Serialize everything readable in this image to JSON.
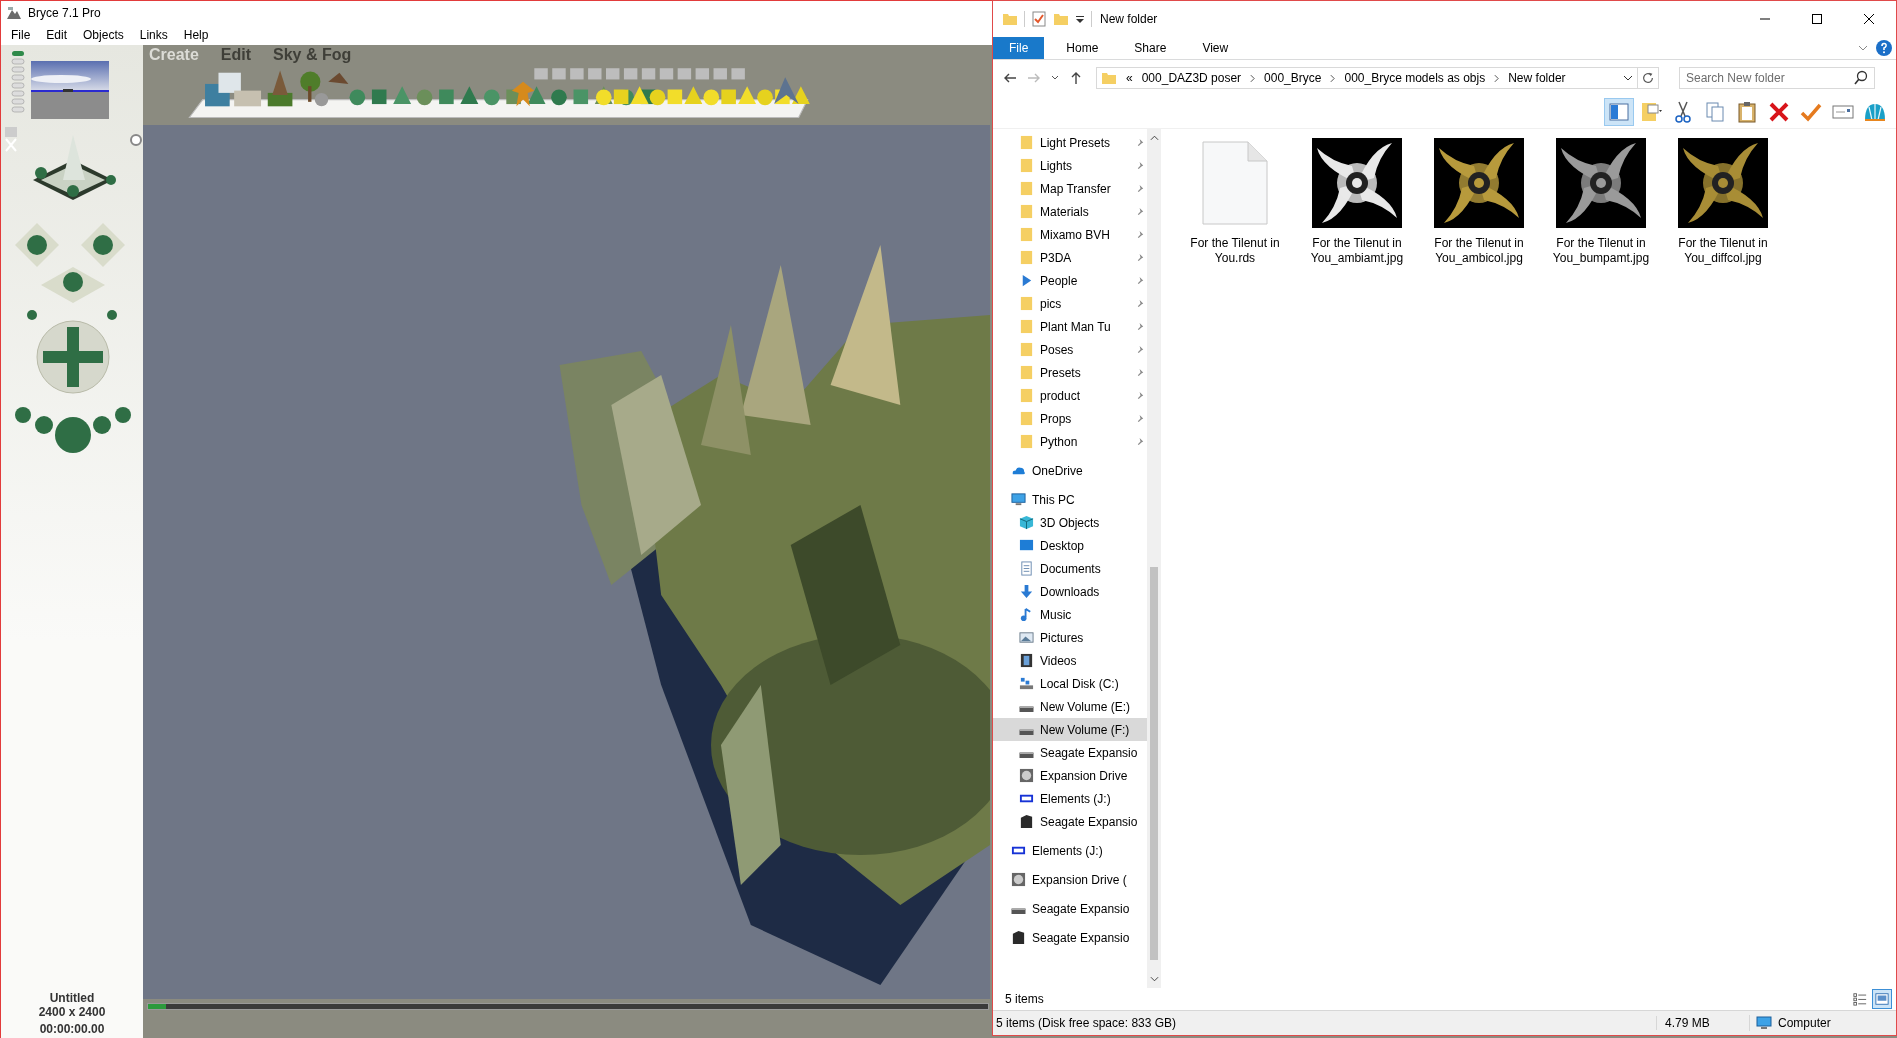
{
  "bryce": {
    "title": "Bryce 7.1  Pro",
    "menu": [
      "File",
      "Edit",
      "Objects",
      "Links",
      "Help"
    ],
    "palette_tabs": [
      {
        "label": "Create",
        "selected": true
      },
      {
        "label": "Edit",
        "selected": false
      },
      {
        "label": "Sky & Fog",
        "selected": false
      }
    ],
    "document": {
      "name": "Untitled",
      "size": "2400 x 2400",
      "time": "00:00:00.00"
    }
  },
  "explorer": {
    "title": "New folder",
    "ribbon_tabs": [
      {
        "label": "File",
        "kind": "file-menu"
      },
      {
        "label": "Home",
        "kind": "tab"
      },
      {
        "label": "Share",
        "kind": "tab"
      },
      {
        "label": "View",
        "kind": "tab"
      }
    ],
    "address": {
      "overflow": "«",
      "path": [
        "000_DAZ3D poser",
        "000_Bryce",
        "000_Bryce models as objs",
        "New folder"
      ]
    },
    "search": {
      "placeholder": "Search New folder"
    },
    "toolbar": [
      {
        "kind": "preview-pane",
        "on": true
      },
      {
        "kind": "properties"
      },
      {
        "kind": "cut"
      },
      {
        "kind": "copy"
      },
      {
        "kind": "paste"
      },
      {
        "kind": "delete"
      },
      {
        "kind": "check"
      },
      {
        "kind": "rename"
      },
      {
        "kind": "shell"
      }
    ],
    "quick_access": [
      {
        "label": "Light Presets",
        "kind": "folder",
        "pinned": true,
        "selected": false
      },
      {
        "label": "Lights",
        "kind": "folder",
        "pinned": true,
        "selected": false
      },
      {
        "label": "Map Transfer",
        "kind": "folder",
        "pinned": true,
        "selected": false
      },
      {
        "label": "Materials",
        "kind": "folder",
        "pinned": true,
        "selected": false
      },
      {
        "label": "Mixamo BVH",
        "kind": "folder",
        "pinned": true,
        "selected": false
      },
      {
        "label": "P3DA",
        "kind": "folder",
        "pinned": true,
        "selected": false
      },
      {
        "label": "People",
        "kind": "people",
        "pinned": true,
        "selected": false
      },
      {
        "label": "pics",
        "kind": "folder",
        "pinned": true,
        "selected": false
      },
      {
        "label": "Plant Man Tu",
        "kind": "folder",
        "pinned": true,
        "selected": false
      },
      {
        "label": "Poses",
        "kind": "folder",
        "pinned": true,
        "selected": false
      },
      {
        "label": "Presets",
        "kind": "folder",
        "pinned": true,
        "selected": false
      },
      {
        "label": "product",
        "kind": "folder",
        "pinned": true,
        "selected": false
      },
      {
        "label": "Props",
        "kind": "folder",
        "pinned": true,
        "selected": false
      },
      {
        "label": "Python",
        "kind": "folder",
        "pinned": true,
        "selected": false
      }
    ],
    "tree": [
      {
        "label": "OneDrive",
        "kind": "cloud",
        "selected": false
      },
      {
        "label": "This PC",
        "kind": "pc",
        "selected": false,
        "children": [
          {
            "label": "3D Objects",
            "kind": "cube",
            "selected": false
          },
          {
            "label": "Desktop",
            "kind": "desktop",
            "selected": false
          },
          {
            "label": "Documents",
            "kind": "document",
            "selected": false
          },
          {
            "label": "Downloads",
            "kind": "download",
            "selected": false
          },
          {
            "label": "Music",
            "kind": "music",
            "selected": false
          },
          {
            "label": "Pictures",
            "kind": "pictures",
            "selected": false
          },
          {
            "label": "Videos",
            "kind": "video",
            "selected": false
          },
          {
            "label": "Local Disk (C:)",
            "kind": "local-disk",
            "selected": false
          },
          {
            "label": "New Volume (E:)",
            "kind": "drive",
            "selected": false
          },
          {
            "label": "New Volume (F:)",
            "kind": "drive",
            "selected": true
          },
          {
            "label": "Seagate Expansio",
            "kind": "drive",
            "selected": false
          },
          {
            "label": "Expansion Drive",
            "kind": "expansion",
            "selected": false
          },
          {
            "label": "Elements (J:)",
            "kind": "wd",
            "selected": false
          },
          {
            "label": "Seagate Expansio",
            "kind": "black-drive",
            "selected": false
          }
        ]
      },
      {
        "label": "Elements (J:)",
        "kind": "wd",
        "selected": false
      },
      {
        "label": "Expansion Drive (",
        "kind": "expansion",
        "selected": false
      },
      {
        "label": "Seagate Expansio",
        "kind": "drive",
        "selected": false
      },
      {
        "label": "Seagate Expansio",
        "kind": "black-drive",
        "selected": false
      }
    ],
    "files": [
      {
        "name": "For the Tilenut in You.rds",
        "kind": "document"
      },
      {
        "name": "For the Tilenut in You_ambiamt.jpg"
      },
      {
        "name": "For the Tilenut in You_ambicol.jpg"
      },
      {
        "name": "For the Tilenut in You_bumpamt.jpg"
      },
      {
        "name": "For the Tilenut in You_diffcol.jpg"
      }
    ],
    "item_count": "5 items",
    "view_modes": [
      {
        "kind": "details",
        "on": false
      },
      {
        "kind": "large-icons",
        "on": true
      }
    ],
    "status_bar": {
      "summary": "5 items (Disk free space: 833 GB)",
      "size": "4.79 MB",
      "location": "Computer"
    }
  }
}
